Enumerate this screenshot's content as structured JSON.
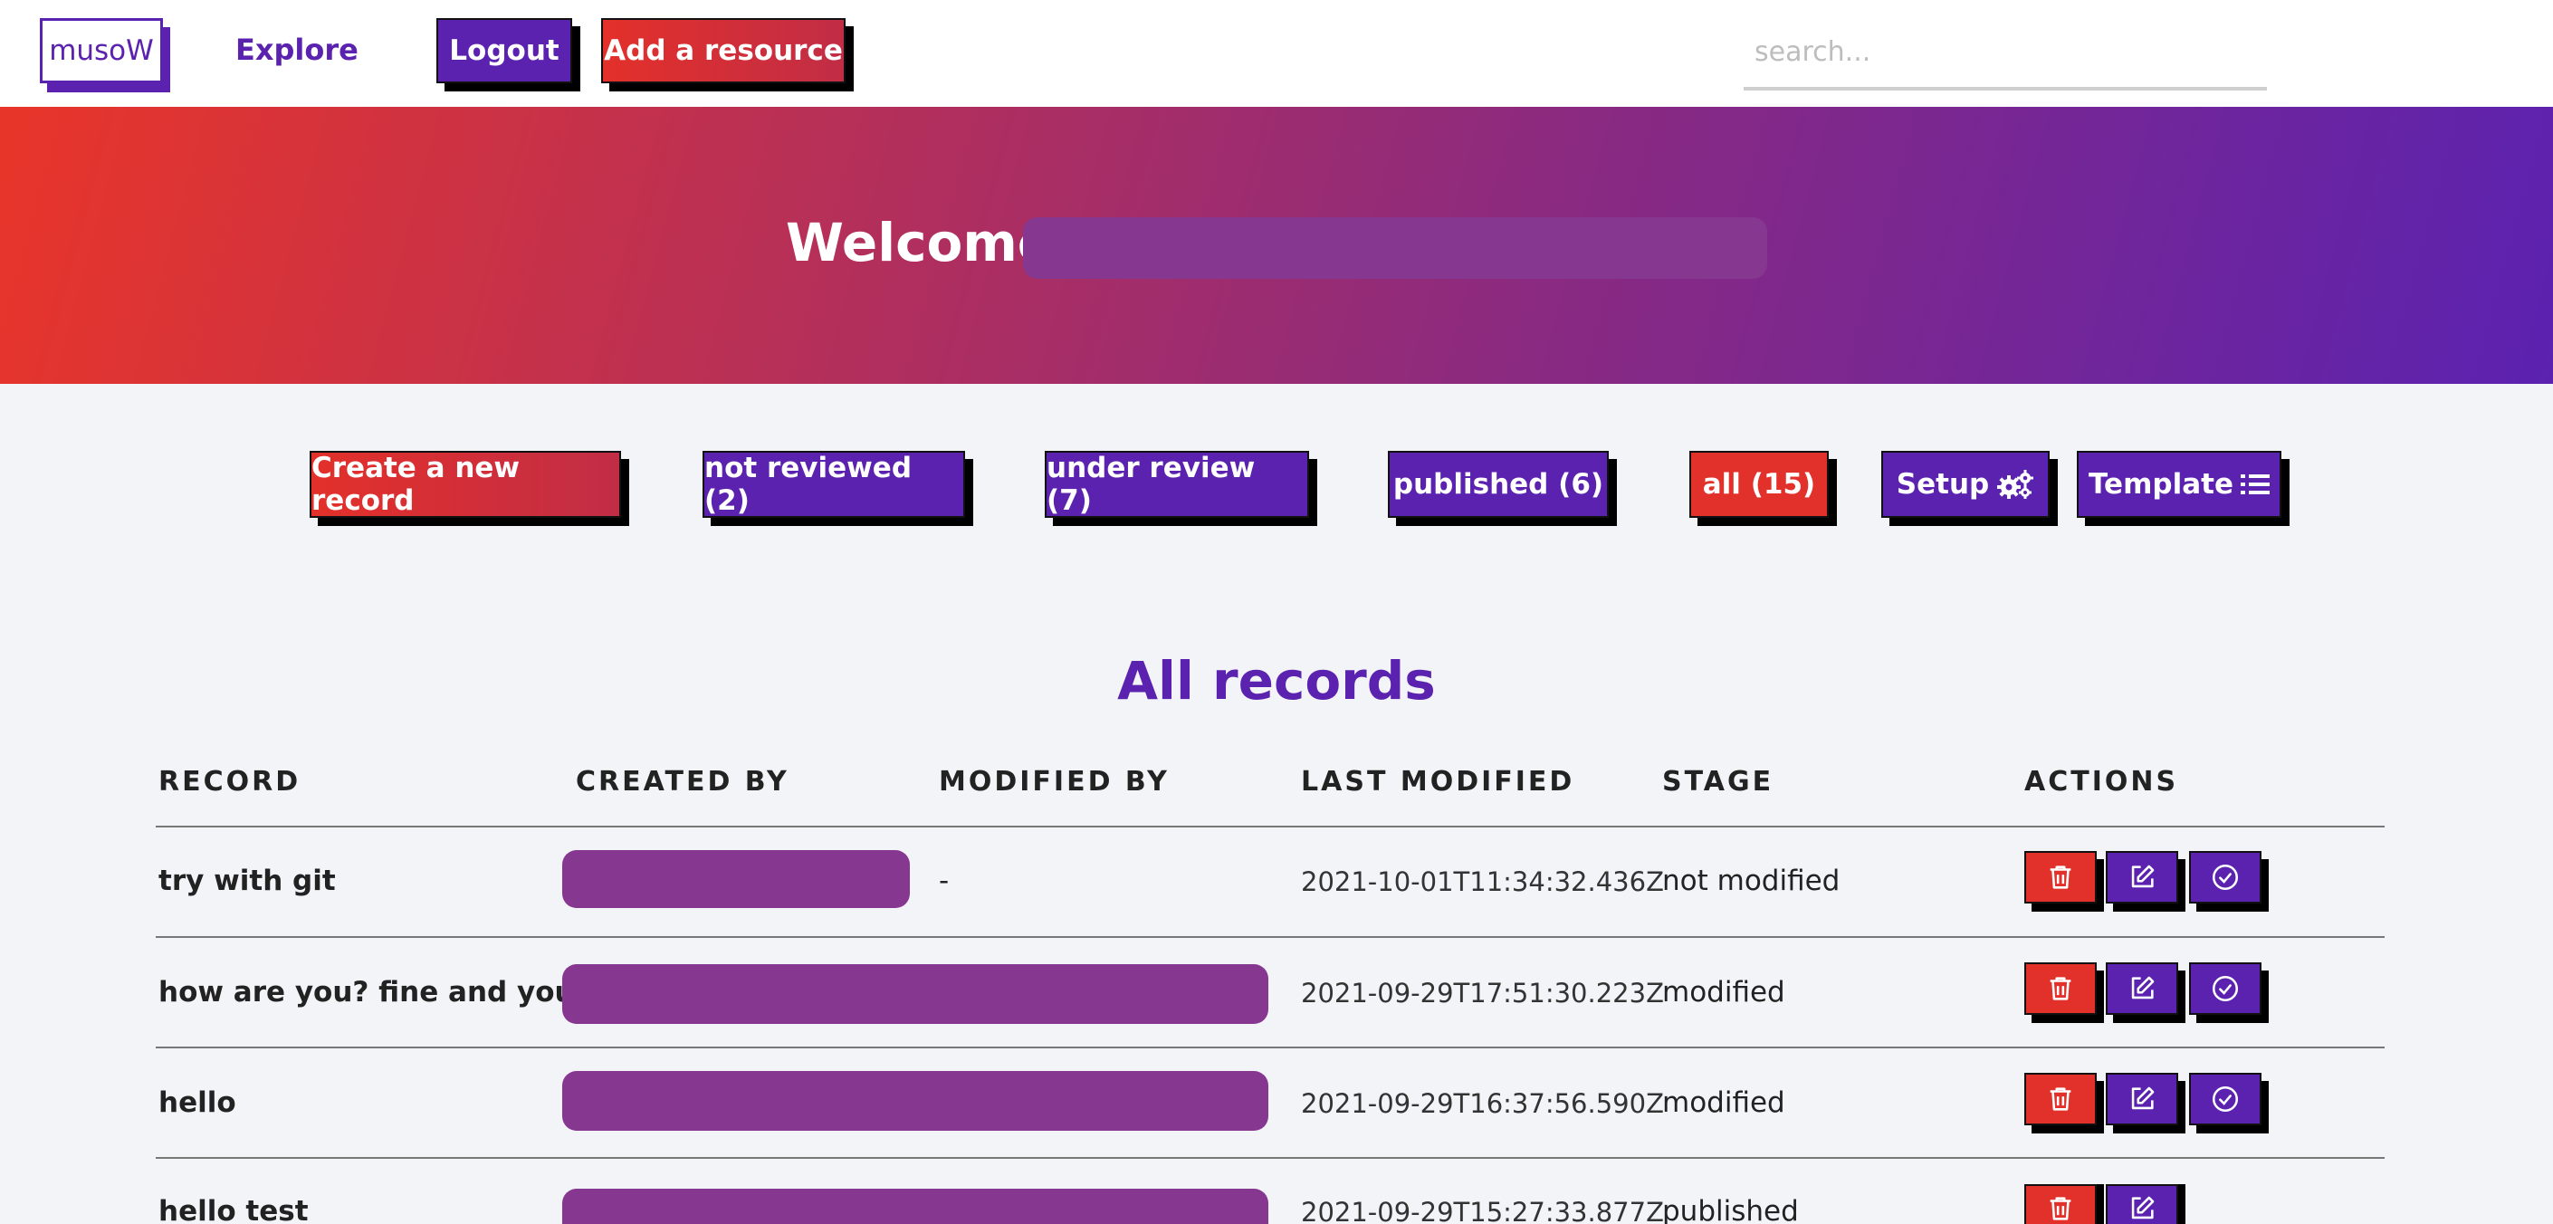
{
  "nav": {
    "logo": "musoW",
    "explore": "Explore",
    "logout": "Logout",
    "add_resource": "Add a resource",
    "search_placeholder": "search..."
  },
  "hero": {
    "welcome": "Welcome"
  },
  "filters": {
    "create": "Create a new record",
    "not_reviewed": "not reviewed (2)",
    "under_review": "under review (7)",
    "published": "published (6)",
    "all": "all (15)",
    "setup": "Setup",
    "template": "Template"
  },
  "section_title": "All records",
  "table": {
    "headers": [
      "RECORD",
      "CREATED BY",
      "MODIFIED BY",
      "LAST MODIFIED",
      "STAGE",
      "ACTIONS"
    ],
    "rows": [
      {
        "record": "try with git",
        "modified_by": "-",
        "last_modified": "2021-10-01T11:34:32.436Z",
        "stage": "not modified"
      },
      {
        "record": "how are you? fine and you",
        "modified_by": "",
        "last_modified": "2021-09-29T17:51:30.223Z",
        "stage": "modified"
      },
      {
        "record": "hello",
        "modified_by": "",
        "last_modified": "2021-09-29T16:37:56.590Z",
        "stage": "modified"
      },
      {
        "record": "hello test",
        "modified_by": "",
        "last_modified": "2021-09-29T15:27:33.877Z",
        "stage": "published"
      }
    ]
  },
  "icons": {
    "setup": "gears-icon",
    "template": "list-icon",
    "delete": "trash-icon",
    "edit": "edit-icon",
    "review": "check-circle-icon"
  },
  "colors": {
    "purple": "#5b22b0",
    "red": "#e2312a",
    "redaction": "#86378f"
  }
}
